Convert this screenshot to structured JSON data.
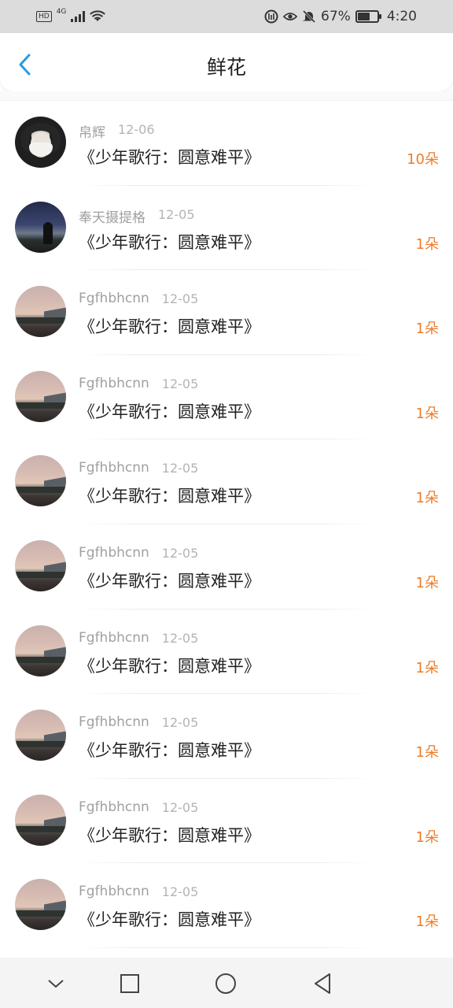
{
  "status_bar": {
    "hd": "HD",
    "network": "4G",
    "battery_percent": "67%",
    "time": "4:20"
  },
  "header": {
    "title": "鲜花",
    "back_icon": "chevron-left-icon",
    "accent_color": "#2a9be0"
  },
  "colors": {
    "amount": "#ee7c2a",
    "name": "#a0a0a0"
  },
  "items": [
    {
      "avatar": "girl-with-mask",
      "name": "帛辉",
      "date": "12-06",
      "title": "《少年歌行：圆意难平》",
      "amount": "10朵"
    },
    {
      "avatar": "night-sky-person",
      "name": "奉天摄提格",
      "date": "12-05",
      "title": "《少年歌行：圆意难平》",
      "amount": "1朵"
    },
    {
      "avatar": "dusk-landscape",
      "name": "Fgfhbhcnn",
      "date": "12-05",
      "title": "《少年歌行：圆意难平》",
      "amount": "1朵"
    },
    {
      "avatar": "dusk-landscape",
      "name": "Fgfhbhcnn",
      "date": "12-05",
      "title": "《少年歌行：圆意难平》",
      "amount": "1朵"
    },
    {
      "avatar": "dusk-landscape",
      "name": "Fgfhbhcnn",
      "date": "12-05",
      "title": "《少年歌行：圆意难平》",
      "amount": "1朵"
    },
    {
      "avatar": "dusk-landscape",
      "name": "Fgfhbhcnn",
      "date": "12-05",
      "title": "《少年歌行：圆意难平》",
      "amount": "1朵"
    },
    {
      "avatar": "dusk-landscape",
      "name": "Fgfhbhcnn",
      "date": "12-05",
      "title": "《少年歌行：圆意难平》",
      "amount": "1朵"
    },
    {
      "avatar": "dusk-landscape",
      "name": "Fgfhbhcnn",
      "date": "12-05",
      "title": "《少年歌行：圆意难平》",
      "amount": "1朵"
    },
    {
      "avatar": "dusk-landscape",
      "name": "Fgfhbhcnn",
      "date": "12-05",
      "title": "《少年歌行：圆意难平》",
      "amount": "1朵"
    },
    {
      "avatar": "dusk-landscape",
      "name": "Fgfhbhcnn",
      "date": "12-05",
      "title": "《少年歌行：圆意难平》",
      "amount": "1朵"
    }
  ],
  "navbar": {
    "icons": [
      "chevron-down-icon",
      "square-icon",
      "circle-icon",
      "triangle-back-icon"
    ]
  }
}
